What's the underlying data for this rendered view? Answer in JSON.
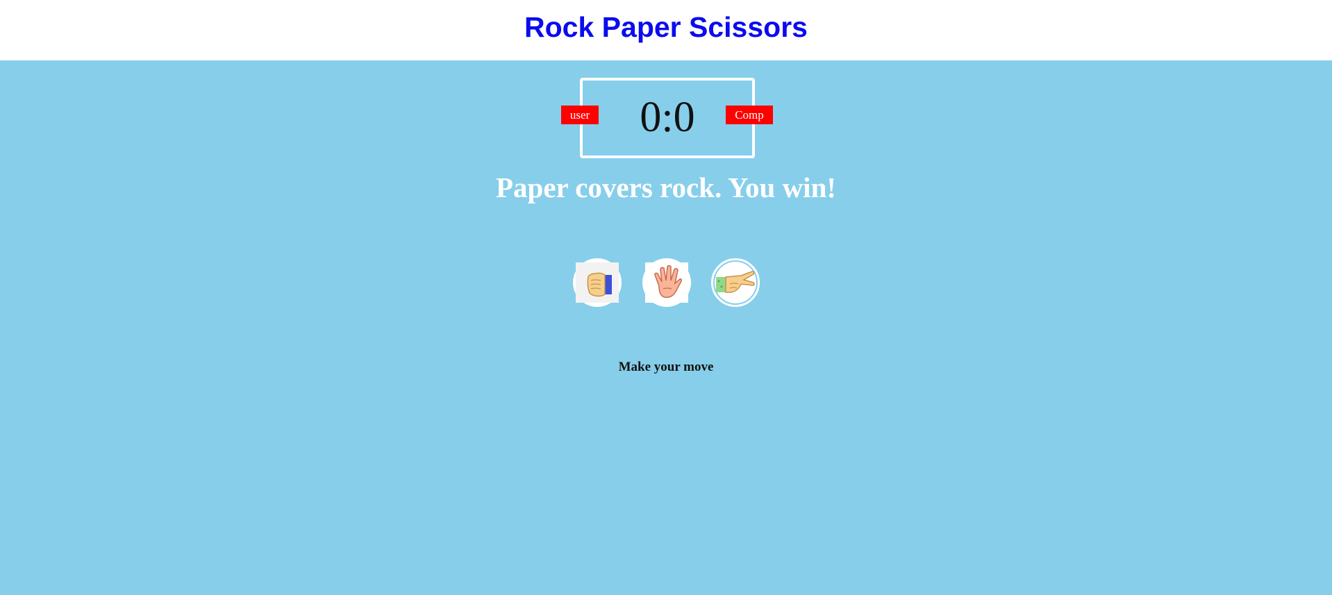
{
  "header": {
    "title": "Rock Paper Scissors"
  },
  "scoreboard": {
    "user_label": "user",
    "comp_label": "Comp",
    "user_score": 0,
    "comp_score": 0,
    "score_text": "0:0"
  },
  "result_message": "Paper covers rock. You win!",
  "choices": [
    {
      "id": "rock",
      "icon": "fist-icon"
    },
    {
      "id": "paper",
      "icon": "open-hand-icon"
    },
    {
      "id": "scissors",
      "icon": "scissors-hand-icon"
    }
  ],
  "prompt": "Make your move",
  "colors": {
    "background": "#87ceeb",
    "title": "#0b0bf0",
    "badge": "#ff0000",
    "result_text": "#ffffff"
  }
}
